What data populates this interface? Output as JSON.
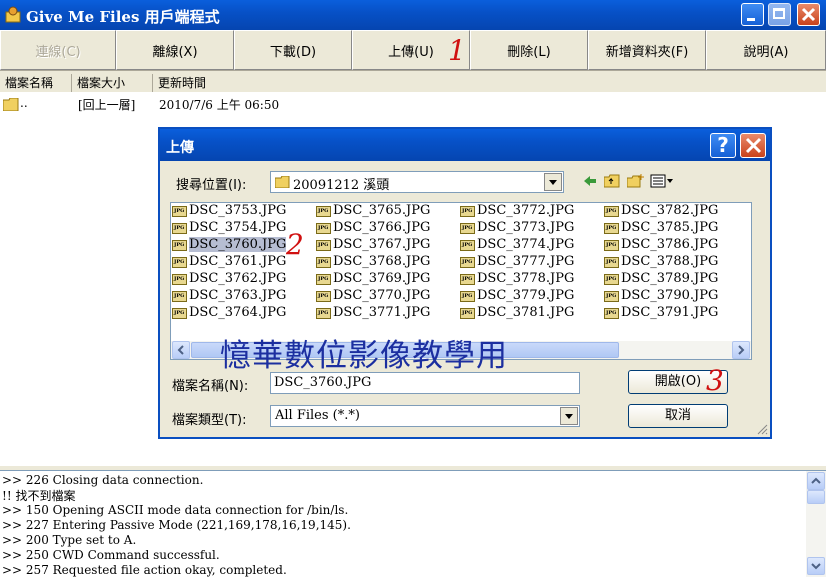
{
  "window": {
    "title": "Give Me Files 用戶端程式"
  },
  "toolbar": {
    "buttons": [
      {
        "label": "連線(C)",
        "enabled": false
      },
      {
        "label": "離線(X)",
        "enabled": true
      },
      {
        "label": "下載(D)",
        "enabled": true
      },
      {
        "label": "上傳(U)",
        "enabled": true
      },
      {
        "label": "刪除(L)",
        "enabled": true
      },
      {
        "label": "新增資料夾(F)",
        "enabled": true
      },
      {
        "label": "說明(A)",
        "enabled": true
      }
    ]
  },
  "file_list": {
    "columns": [
      "檔案名稱",
      "檔案大小",
      "更新時間"
    ],
    "rows": [
      {
        "name": "..",
        "size": "[回上一層]",
        "modified": "2010/7/6 上午 06:50"
      }
    ]
  },
  "log": {
    "lines": [
      ">> 226 Closing data connection.",
      "!! 找不到檔案",
      ">> 150 Opening ASCII mode data connection for /bin/ls.",
      ">> 227 Entering Passive Mode (221,169,178,16,19,145).",
      ">> 200 Type set to A.",
      ">> 250 CWD Command successful.",
      ">> 257 Requested file action okay, completed."
    ]
  },
  "upload_dialog": {
    "title": "上傳",
    "look_in_label": "搜尋位置(I):",
    "look_in_value": "20091212 溪頭",
    "files": [
      [
        "DSC_3753.JPG",
        "DSC_3754.JPG",
        "DSC_3760.JPG",
        "DSC_3761.JPG",
        "DSC_3762.JPG",
        "DSC_3763.JPG",
        "DSC_3764.JPG"
      ],
      [
        "DSC_3765.JPG",
        "DSC_3766.JPG",
        "DSC_3767.JPG",
        "DSC_3768.JPG",
        "DSC_3769.JPG",
        "DSC_3770.JPG",
        "DSC_3771.JPG"
      ],
      [
        "DSC_3772.JPG",
        "DSC_3773.JPG",
        "DSC_3774.JPG",
        "DSC_3777.JPG",
        "DSC_3778.JPG",
        "DSC_3779.JPG",
        "DSC_3781.JPG"
      ],
      [
        "DSC_3782.JPG",
        "DSC_3785.JPG",
        "DSC_3786.JPG",
        "DSC_3788.JPG",
        "DSC_3789.JPG",
        "DSC_3790.JPG",
        "DSC_3791.JPG"
      ]
    ],
    "selected_file": "DSC_3760.JPG",
    "filename_label": "檔案名稱(N):",
    "filename_value": "DSC_3760.JPG",
    "filetype_label": "檔案類型(T):",
    "filetype_value": "All Files (*.*)",
    "open_button": "開啟(O)",
    "cancel_button": "取消"
  },
  "overlay": {
    "watermark": "憶華數位影像教學用",
    "step1": "1",
    "step2": "2",
    "step3": "3"
  },
  "colors": {
    "titlebar": "#0751c7",
    "annotation": "#d01010",
    "watermark": "#1c2fa0",
    "selection": "#b6bdd2"
  }
}
